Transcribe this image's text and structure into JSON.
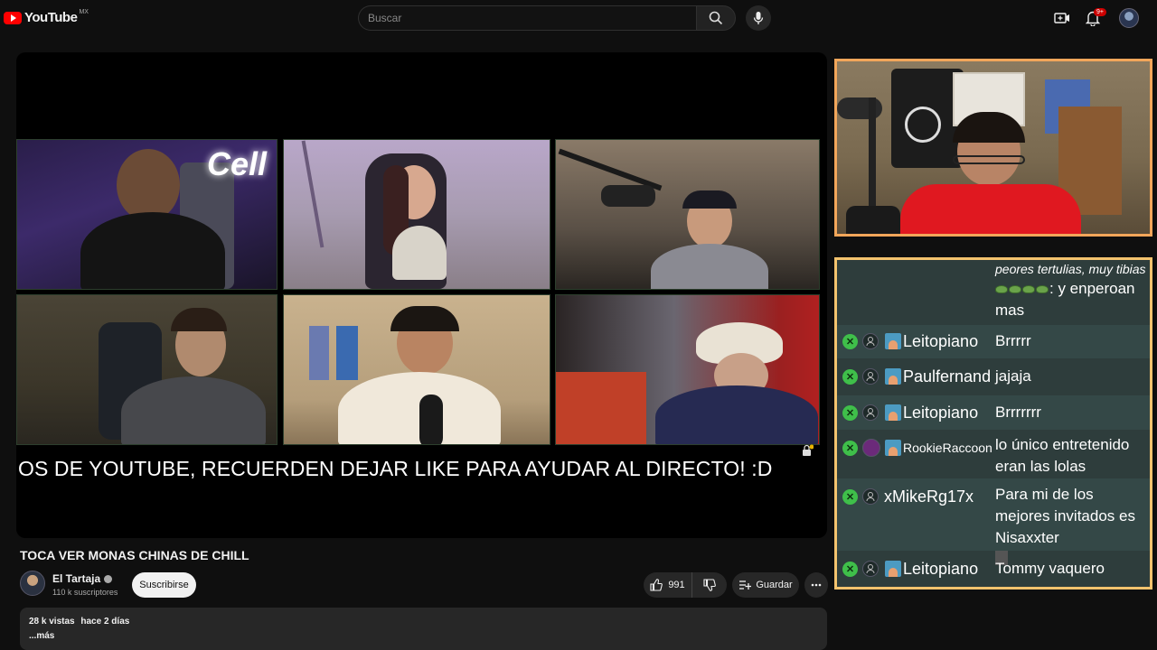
{
  "header": {
    "logo_text": "YouTube",
    "country": "MX",
    "search_placeholder": "Buscar",
    "notifications_badge": "9+"
  },
  "video": {
    "overlay_banner": "OS DE YOUTUBE, RECUERDEN DEJAR LIKE PARA AYUDAR AL DIRECTO! :D",
    "tile_sign": "Cell",
    "title": "TOCA VER MONAS CHINAS DE CHILL",
    "channel": {
      "name": "El Tartaja",
      "subscribers": "110 k suscriptores",
      "subscribe_label": "Suscribirse"
    },
    "actions": {
      "like_count": "991",
      "save_label": "Guardar"
    },
    "description": {
      "views": "28 k vistas",
      "date": "hace 2 días",
      "more_label": "...más"
    }
  },
  "chat": {
    "partial_top": {
      "line1": "peores tertulias, muy tibias",
      "line2": ": y enperoan",
      "line3": "mas"
    },
    "messages": [
      {
        "user": "Leitopiano",
        "text": "Brrrrr"
      },
      {
        "user": "Paulfernand",
        "text": "jajaja"
      },
      {
        "user": "Leitopiano",
        "text": "Brrrrrrr"
      },
      {
        "user": "RookieRaccoon",
        "text": "lo único entretenido eran las lolas"
      },
      {
        "user": "xMikeRg17x",
        "text": "Para mi de los mejores invitados es Nisaxxter"
      },
      {
        "user": "Leitopiano",
        "text": "Tommy vaquero"
      }
    ]
  },
  "colors": {
    "cam_border": "#f2a65a",
    "chat_border": "#f4c36e",
    "chat_bg": "#2e3d3c",
    "mod_badge": "#3fbf4a",
    "yt_red": "#ff0000"
  }
}
